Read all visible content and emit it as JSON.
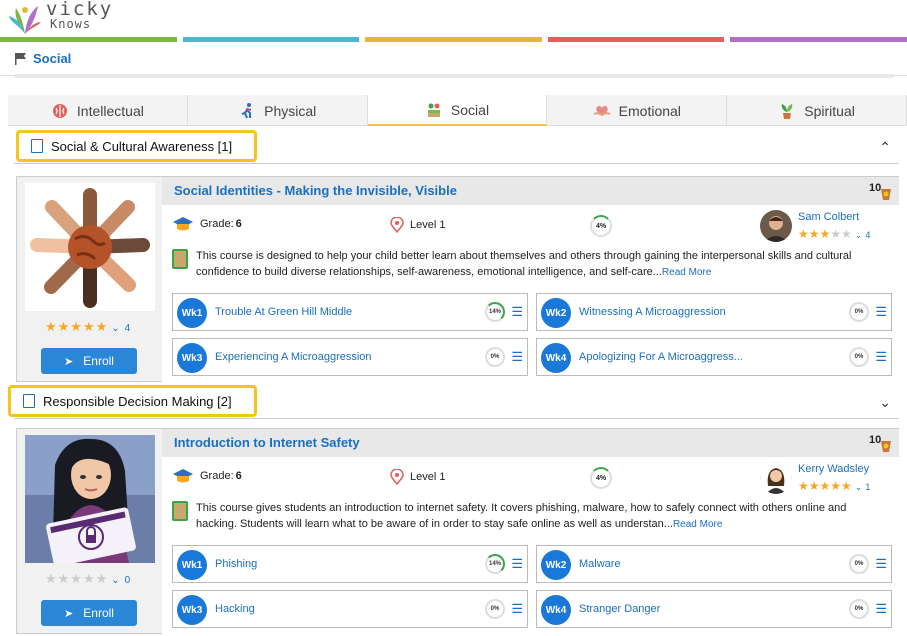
{
  "brand": {
    "line1": "vicky",
    "line2": "Knows"
  },
  "colors": {
    "bar": [
      "#7ab648",
      "#4cb8d0",
      "#e3b83a",
      "#e06060",
      "#b070c8"
    ],
    "link": "#1a6fc0",
    "highlight": "#f5c518",
    "star": "#f5a623"
  },
  "breadcrumb": {
    "icon": "flag-icon",
    "label": "Social"
  },
  "tabs": [
    {
      "label": "Intellectual",
      "icon": "brain-icon"
    },
    {
      "label": "Physical",
      "icon": "running-person-icon"
    },
    {
      "label": "Social",
      "icon": "people-icon",
      "active": true
    },
    {
      "label": "Emotional",
      "icon": "heart-hands-icon"
    },
    {
      "label": "Spiritual",
      "icon": "plant-icon"
    }
  ],
  "sections": [
    {
      "title": "Social & Cultural Awareness [1]",
      "course": {
        "title": "Social Identities - Making the Invisible, Visible",
        "rating_count": "4",
        "enroll": "Enroll",
        "grade_label": "Grade:",
        "grade": "6",
        "level": "Level 1",
        "progress": "4%",
        "author": "Sam Colbert",
        "author_rating_count": "4",
        "description": "This course is designed to help your child better learn about themselves and others through gaining the interpersonal skills and cultural confidence to build diverse relationships, self-awareness, emotional intelligence, and self-care...",
        "read_more": "Read More",
        "weeks": [
          {
            "badge": "Wk1",
            "title": "Trouble At Green Hill Middle",
            "pct": "14%"
          },
          {
            "badge": "Wk2",
            "title": "Witnessing A Microaggression",
            "pct": "0%"
          },
          {
            "badge": "Wk3",
            "title": "Experiencing A Microaggression",
            "pct": "0%"
          },
          {
            "badge": "Wk4",
            "title": "Apologizing For A Microaggress...",
            "pct": "0%"
          }
        ]
      }
    },
    {
      "title": "Responsible Decision Making [2]",
      "course": {
        "title": "Introduction to Internet Safety",
        "rating_count": "0",
        "enroll": "Enroll",
        "grade_label": "Grade:",
        "grade": "6",
        "level": "Level 1",
        "progress": "4%",
        "author": "Kerry Wadsley",
        "author_rating_count": "1",
        "description": "This course gives students an introduction to internet safety. It covers phishing, malware, how to safely connect with others online and hacking. Students will learn what to be aware of in order to stay safe online as well as understan...",
        "read_more": "Read More",
        "weeks": [
          {
            "badge": "Wk1",
            "title": "Phishing",
            "pct": "14%"
          },
          {
            "badge": "Wk2",
            "title": "Malware",
            "pct": "0%"
          },
          {
            "badge": "Wk3",
            "title": "Hacking",
            "pct": "0%"
          },
          {
            "badge": "Wk4",
            "title": "Stranger Danger",
            "pct": "0%"
          }
        ]
      }
    }
  ]
}
